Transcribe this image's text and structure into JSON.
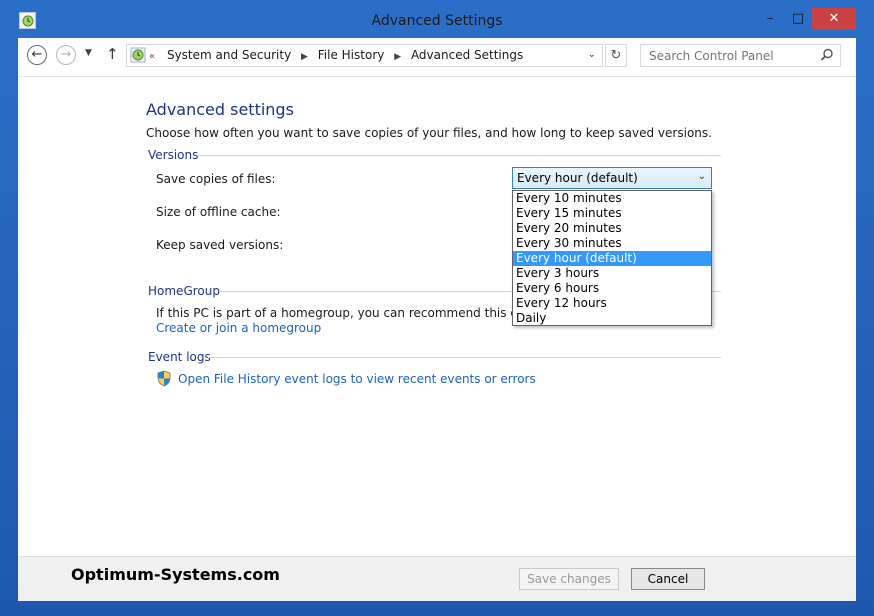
{
  "window": {
    "title": "Advanced Settings",
    "controls": {
      "minimize": "–",
      "maximize": "□",
      "close": "✕"
    }
  },
  "addressbar": {
    "overflow": "«",
    "crumbs": [
      "System and Security",
      "File History",
      "Advanced Settings"
    ],
    "search_placeholder": "Search Control Panel"
  },
  "main": {
    "title": "Advanced settings",
    "description": "Choose how often you want to save copies of your files, and how long to keep saved versions.",
    "versions": {
      "heading": "Versions",
      "save_copies_label": "Save copies of files:",
      "offline_cache_label": "Size of offline cache:",
      "keep_versions_label": "Keep saved versions:",
      "save_copies_value": "Every hour (default)",
      "options": [
        "Every 10 minutes",
        "Every 15 minutes",
        "Every 20 minutes",
        "Every 30 minutes",
        "Every hour (default)",
        "Every 3 hours",
        "Every 6 hours",
        "Every 12 hours",
        "Daily"
      ],
      "highlighted_index": 4
    },
    "homegroup": {
      "heading": "HomeGroup",
      "text": "If this PC is part of a homegroup, you can recommend this drive to",
      "link": "Create or join a homegroup"
    },
    "event_logs": {
      "heading": "Event logs",
      "link": "Open File History event logs to view recent events or errors"
    }
  },
  "footer": {
    "watermark": "Optimum-Systems.com",
    "save_label": "Save changes",
    "cancel_label": "Cancel"
  },
  "colors": {
    "accent": "#1e3287",
    "link": "#1c62b9",
    "selection": "#3399ff",
    "close": "#c94141"
  }
}
